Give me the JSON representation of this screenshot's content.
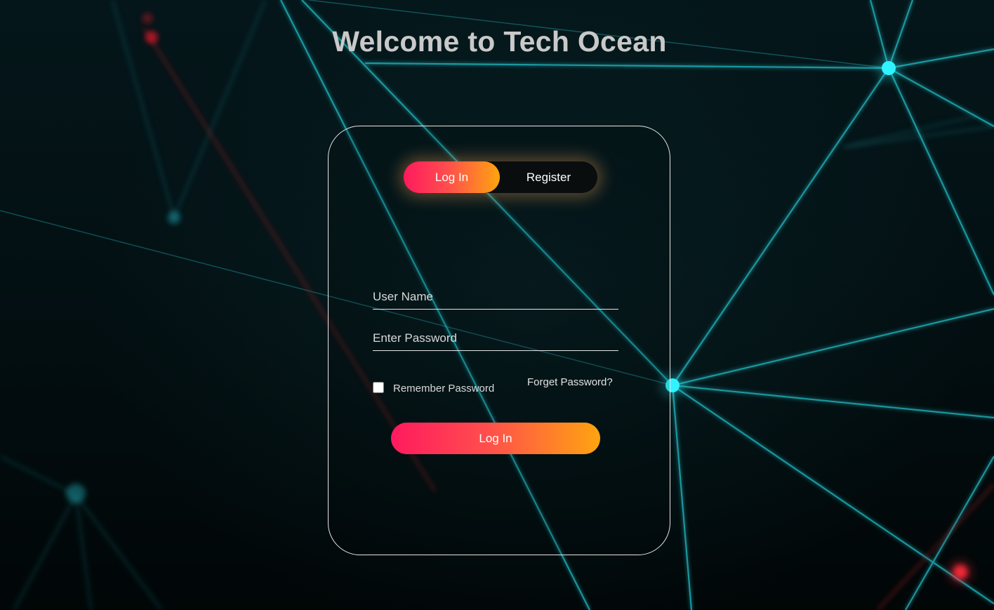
{
  "page": {
    "title": "Welcome to Tech Ocean"
  },
  "auth_toggle": {
    "login_label": "Log In",
    "register_label": "Register",
    "active": "login"
  },
  "form": {
    "username_placeholder": "User Name",
    "username_value": "",
    "password_placeholder": "Enter Password",
    "password_value": "",
    "remember_label": "Remember Password",
    "remember_checked": false,
    "forgot_label": "Forget Password?",
    "submit_label": "Log In"
  },
  "colors": {
    "background": "#020a0c",
    "accent_gradient_start": "#ff1a5e",
    "accent_gradient_end": "#ffa410",
    "network_line": "#21c8d2",
    "network_node": "#2ff3ff",
    "red_node": "#ff2a3a",
    "title_text": "#c9c9c9"
  },
  "icons": {
    "background": "network-graph-background"
  }
}
